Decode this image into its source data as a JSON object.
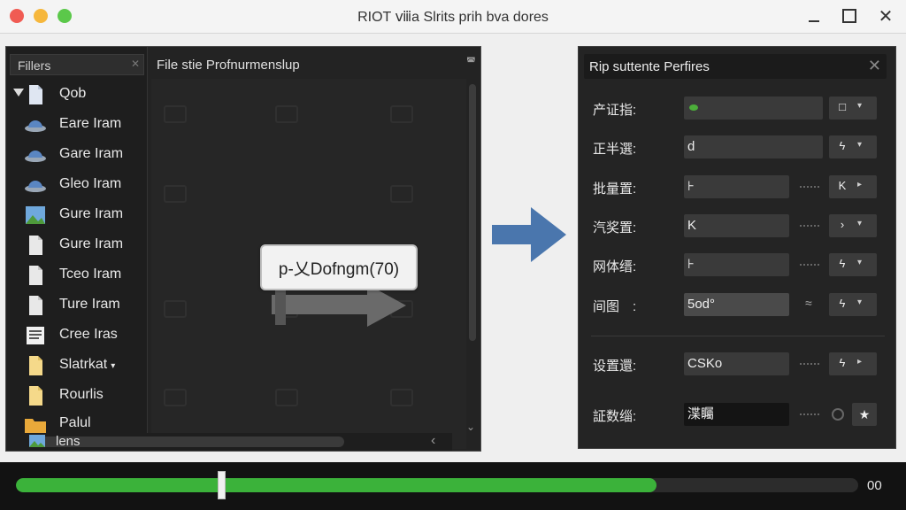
{
  "window": {
    "title": "RIOT ⅷa Slrits prih bva dores",
    "min_icon": "minimize-icon",
    "max_icon": "maximize-icon",
    "close_label": "✕"
  },
  "file_list": {
    "header": "Fillers",
    "header_icon": "✕",
    "items": [
      {
        "label": "Qob",
        "icon": "file-icon",
        "expanded": true
      },
      {
        "label": "Eare Iram",
        "icon": "hat-icon"
      },
      {
        "label": "Gare Iram",
        "icon": "hat-icon"
      },
      {
        "label": "Gleo Iram",
        "icon": "hat-icon"
      },
      {
        "label": "Gure Iram",
        "icon": "image-icon"
      },
      {
        "label": "Gure Iram",
        "icon": "file-icon"
      },
      {
        "label": "Tceo Iram",
        "icon": "file-icon"
      },
      {
        "label": "Ture Iram",
        "icon": "file-icon"
      },
      {
        "label": "Cree Iras",
        "icon": "document-icon"
      },
      {
        "label": "Slatrkat",
        "icon": "note-icon",
        "caret": "▾"
      },
      {
        "label": "Rourlis",
        "icon": "note-icon"
      },
      {
        "label": "Palul",
        "icon": "folder-icon"
      }
    ]
  },
  "middle": {
    "header": "File stie Profnurmenslup",
    "drag_tooltip": "p-乂Dofngm(70)",
    "bottom_label": "lens",
    "scroll_top_icon": "◚",
    "scroll_down_icon": "⌄",
    "scroll_left_icon": "‹"
  },
  "properties": {
    "title": "Rip suttente Perfires",
    "close_label": "✕",
    "rows": [
      {
        "label": "产证指:",
        "value": "",
        "value_style": "green-dot",
        "btn_icon": "□",
        "btn_drop": "▾"
      },
      {
        "label": "正半選:",
        "value": "d",
        "btn_icon": "ϟ",
        "btn_drop": "▾"
      },
      {
        "label": "批量置:",
        "value": "⊦",
        "btn_icon": "K",
        "btn_drop": "▸",
        "dots": true
      },
      {
        "label": "汽奖置:",
        "value": "K",
        "btn_icon": "›",
        "btn_drop": "▾",
        "dots": true
      },
      {
        "label": "网体缙:",
        "value": "⊦",
        "btn_icon": "ϟ",
        "btn_drop": "▾",
        "dots": true
      },
      {
        "label": "间图　:",
        "value": "5od°",
        "btn_icon": "ϟ",
        "btn_drop": "▾",
        "sym": "≈"
      },
      {
        "label": "设置還:",
        "value": "CSKo",
        "btn_icon": "ϟ",
        "btn_drop": "▸",
        "dots": true
      },
      {
        "label": "証数缁:",
        "value": "渫矚",
        "value_style": "dark",
        "dots": true,
        "circle": true,
        "star": "★"
      }
    ]
  },
  "progress": {
    "value_percent": 76,
    "handle_percent": 24,
    "time_label": "00",
    "color": "#3bb23a"
  }
}
